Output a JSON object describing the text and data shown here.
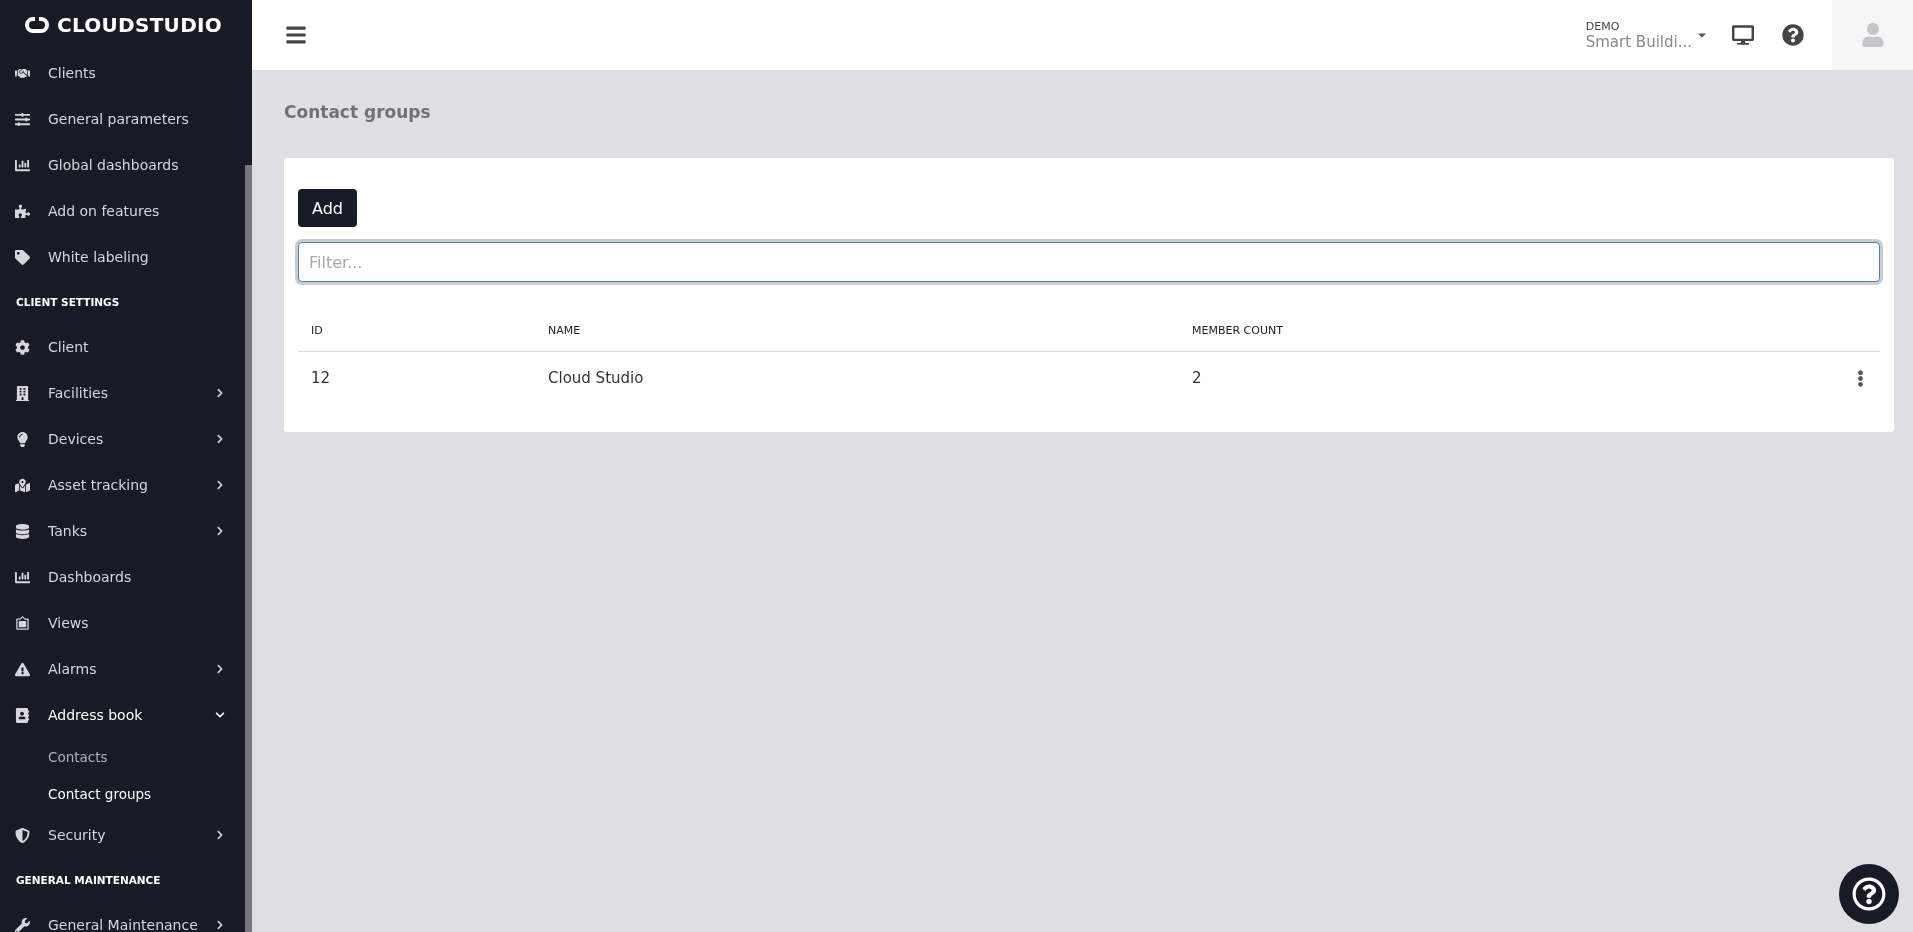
{
  "logo": "CLOUDSTUDIO",
  "sidebar": {
    "items": [
      {
        "kind": "item",
        "label": "Clients"
      },
      {
        "kind": "item",
        "label": "General parameters"
      },
      {
        "kind": "item",
        "label": "Global dashboards"
      },
      {
        "kind": "item",
        "label": "Add on features"
      },
      {
        "kind": "item",
        "label": "White labeling"
      },
      {
        "kind": "section",
        "label": "CLIENT SETTINGS"
      },
      {
        "kind": "item",
        "label": "Client"
      },
      {
        "kind": "item",
        "label": "Facilities",
        "expanded": false
      },
      {
        "kind": "item",
        "label": "Devices",
        "expanded": false
      },
      {
        "kind": "item",
        "label": "Asset tracking",
        "expanded": false
      },
      {
        "kind": "item",
        "label": "Tanks",
        "expanded": false
      },
      {
        "kind": "item",
        "label": "Dashboards"
      },
      {
        "kind": "item",
        "label": "Views"
      },
      {
        "kind": "item",
        "label": "Alarms",
        "expanded": false
      },
      {
        "kind": "item",
        "label": "Address book",
        "expanded": true,
        "children": [
          {
            "label": "Contacts",
            "selected": false
          },
          {
            "label": "Contact groups",
            "selected": true
          }
        ]
      },
      {
        "kind": "item",
        "label": "Security",
        "expanded": false
      },
      {
        "kind": "section",
        "label": "GENERAL MAINTENANCE"
      },
      {
        "kind": "item",
        "label": "General Maintenance",
        "expanded": false
      }
    ]
  },
  "header": {
    "account_label": "DEMO",
    "account_name": "Smart Buildi..."
  },
  "page_title": "Contact groups",
  "add_button": "Add",
  "filter": {
    "placeholder": "Filter..."
  },
  "table": {
    "columns": [
      "ID",
      "NAME",
      "MEMBER COUNT"
    ],
    "rows": [
      {
        "cells": [
          "12",
          "Cloud Studio",
          "2"
        ]
      }
    ]
  }
}
